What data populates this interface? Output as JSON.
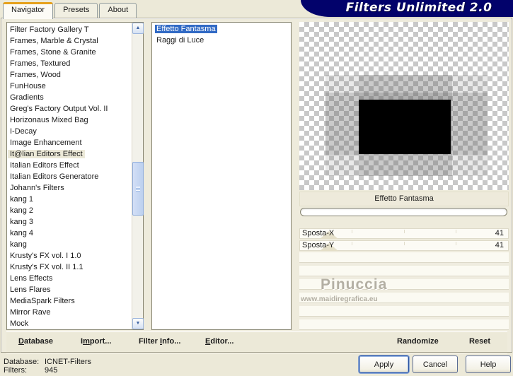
{
  "window": {
    "title": "Filters Unlimited 2.0"
  },
  "tabs": [
    {
      "label": "Navigator",
      "state": "active"
    },
    {
      "label": "Presets"
    },
    {
      "label": "About"
    }
  ],
  "category_list": {
    "items": [
      {
        "label": "Filter Factory Gallery T"
      },
      {
        "label": "Frames, Marble & Crystal"
      },
      {
        "label": "Frames, Stone & Granite"
      },
      {
        "label": "Frames, Textured"
      },
      {
        "label": "Frames, Wood"
      },
      {
        "label": "FunHouse"
      },
      {
        "label": "Gradients"
      },
      {
        "label": "Greg's Factory Output Vol. II"
      },
      {
        "label": "Horizonaus Mixed Bag"
      },
      {
        "label": "I-Decay"
      },
      {
        "label": "Image Enhancement"
      },
      {
        "label": "It@lian Editors Effect",
        "state": "selected"
      },
      {
        "label": "Italian Editors Effect"
      },
      {
        "label": "Italian Editors Generatore"
      },
      {
        "label": "Johann's Filters"
      },
      {
        "label": "kang 1"
      },
      {
        "label": "kang 2"
      },
      {
        "label": "kang 3"
      },
      {
        "label": "kang 4"
      },
      {
        "label": "kang"
      },
      {
        "label": "Krusty's FX vol. I 1.0"
      },
      {
        "label": "Krusty's FX vol. II 1.1"
      },
      {
        "label": "Lens Effects"
      },
      {
        "label": "Lens Flares"
      },
      {
        "label": "MediaSpark Filters"
      },
      {
        "label": "Mirror Rave"
      },
      {
        "label": "Mock"
      }
    ],
    "selected": "It@lian Editors Effect"
  },
  "filter_list": {
    "items": [
      {
        "label": "Effetto Fantasma",
        "state": "selected"
      },
      {
        "label": "Raggi di Luce"
      }
    ],
    "selected": "Effetto Fantasma"
  },
  "preview": {
    "filter_title": "Effetto Fantasma",
    "progress_value": 0
  },
  "sliders": [
    {
      "label": "Sposta-X",
      "value": "41"
    },
    {
      "label": "Sposta-Y",
      "value": "41"
    }
  ],
  "watermark": {
    "name": "Pinuccia",
    "url": "www.maidiregrafica.eu"
  },
  "toolbar": {
    "items": [
      {
        "label": "Database",
        "u": 0
      },
      {
        "label": "Import...",
        "u": 1
      },
      {
        "label": "Filter Info...",
        "u": 7
      },
      {
        "label": "Editor...",
        "u": 0
      },
      {
        "label": "Randomize",
        "u": -1
      },
      {
        "label": "Reset",
        "u": -1
      }
    ]
  },
  "status": {
    "database_label": "Database:",
    "database_value": "ICNET-Filters",
    "filters_label": "Filters:",
    "filters_value": "945"
  },
  "action_buttons": [
    {
      "label": "Apply",
      "state": "focused"
    },
    {
      "label": "Cancel"
    },
    {
      "label": "Help"
    }
  ],
  "colors": {
    "banner": "#02026b",
    "selection": "#316ac5",
    "dialog_face": "#ece9d8",
    "checker_gray": "#c8c8c8",
    "watermark": "#b3afa3",
    "tab_accent": "#e6a11c"
  }
}
